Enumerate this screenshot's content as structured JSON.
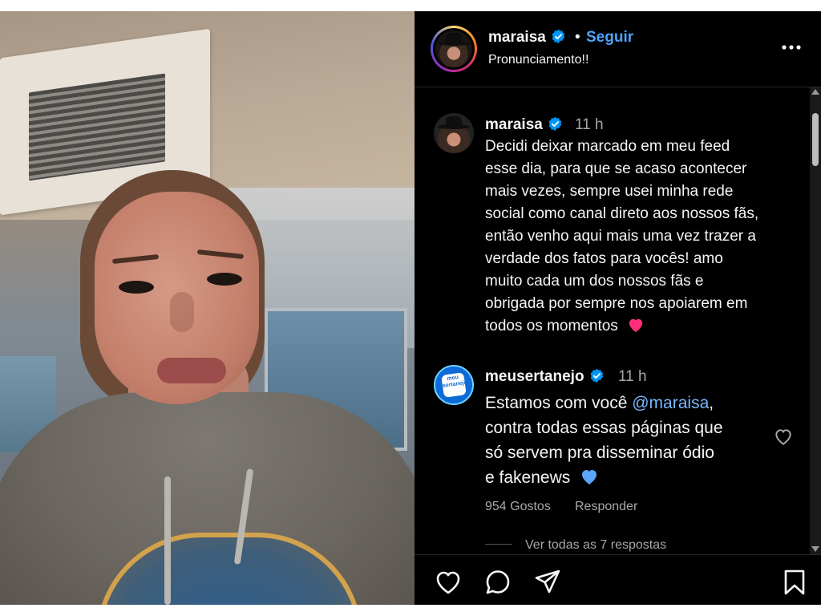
{
  "post": {
    "username": "maraisa",
    "verified": true,
    "separator": "•",
    "follow_label": "Seguir",
    "caption": "Pronunciamento!!"
  },
  "comments": [
    {
      "username": "maraisa",
      "verified": true,
      "time": "11 h",
      "lines": [
        "Decidi deixar marcado em meu feed",
        "esse dia, para que se acaso acontecer",
        "mais vezes, sempre usei minha rede",
        "social como canal direto aos nossos fãs,",
        "então venho aqui mais uma vez trazer a",
        "verdade dos fatos para vocês! amo",
        "muito cada um dos nossos fãs e",
        "obrigada por sempre nos apoiarem em",
        "todos os momentos"
      ],
      "emoji": "heart-pink"
    },
    {
      "username": "meusertanejo",
      "verified": true,
      "time": "11 h",
      "avatar_text": "meu sertanejo",
      "line1_prefix": "Estamos com você ",
      "mention": "@maraisa",
      "line1_suffix": ",",
      "lines_rest": [
        "contra todas essas páginas que",
        "só servem pra disseminar ódio",
        "e fakenews"
      ],
      "emoji": "heart-blue",
      "likes": "954 Gostos",
      "reply_label": "Responder",
      "view_replies": "Ver todas as 7 respostas"
    }
  ],
  "icons": {
    "more": "more-horizontal-icon",
    "like": "heart-outline-icon",
    "comment": "comment-icon",
    "share": "send-icon",
    "save": "bookmark-icon",
    "verified": "verified-badge-icon"
  },
  "colors": {
    "background": "#000000",
    "text": "#f5f5f5",
    "muted": "#a8a8a8",
    "link": "#4da3ff",
    "verified": "#0095f6",
    "heart_pink": "#ff2d7a",
    "heart_blue": "#5aa6ff"
  }
}
